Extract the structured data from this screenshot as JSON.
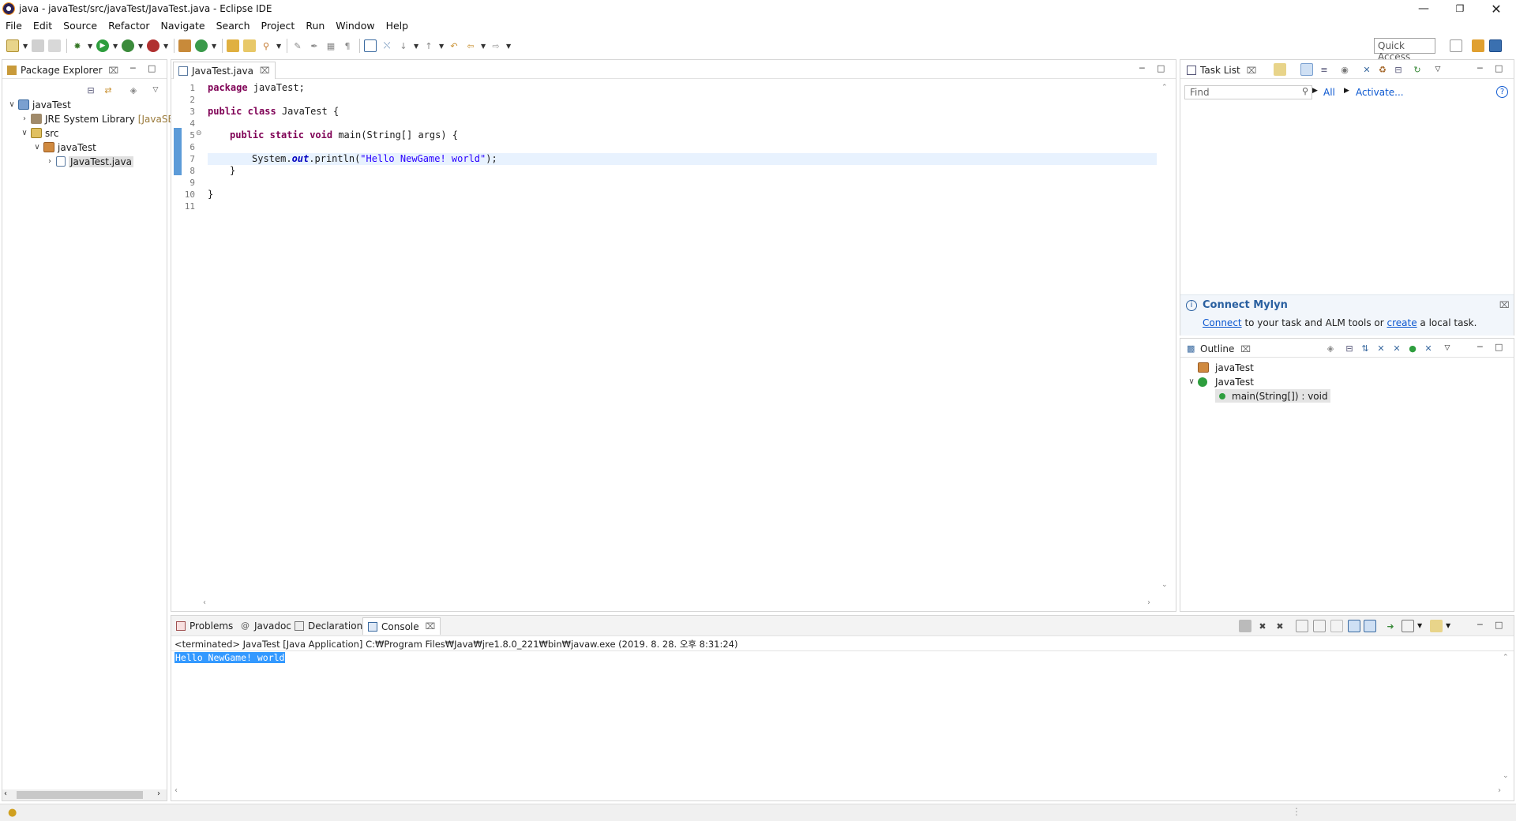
{
  "window": {
    "title": "java - javaTest/src/javaTest/JavaTest.java - Eclipse IDE"
  },
  "menu": [
    "File",
    "Edit",
    "Source",
    "Refactor",
    "Navigate",
    "Search",
    "Project",
    "Run",
    "Window",
    "Help"
  ],
  "toolbar": {
    "quick_access": "Quick Access"
  },
  "package_explorer": {
    "tab_label": "Package Explorer",
    "tree": {
      "project": "javaTest",
      "jre": "JRE System Library",
      "jre_suffix": "[JavaSE-",
      "src": "src",
      "package": "javaTest",
      "file": "JavaTest.java"
    }
  },
  "editor": {
    "tab_label": "JavaTest.java",
    "line_numbers": [
      "1",
      "2",
      "3",
      "4",
      "5",
      "6",
      "7",
      "8",
      "9",
      "10",
      "11"
    ],
    "code": {
      "l1_kw": "package",
      "l1_rest": " javaTest;",
      "l3_kw1": "public",
      "l3_kw2": "class",
      "l3_rest": " JavaTest {",
      "l5_kw1": "public",
      "l5_kw2": "static",
      "l5_kw3": "void",
      "l5_rest": " main(String[] args) {",
      "l7_a": "System.",
      "l7_field": "out",
      "l7_b": ".println(",
      "l7_str": "\"Hello NewGame! world\"",
      "l7_c": ");",
      "l8": "}",
      "l10": "}"
    }
  },
  "task_list": {
    "tab_label": "Task List",
    "find_placeholder": "Find",
    "all_label": "All",
    "activate_label": "Activate..."
  },
  "mylyn": {
    "title": "Connect Mylyn",
    "connect_link": "Connect",
    "middle_text": " to your task and ALM tools or ",
    "create_link": "create",
    "end_text": " a local task."
  },
  "outline": {
    "tab_label": "Outline",
    "package": "javaTest",
    "class": "JavaTest",
    "method": "main(String[]) : void"
  },
  "bottom_tabs": {
    "problems": "Problems",
    "javadoc": "Javadoc",
    "declaration": "Declaration",
    "console": "Console"
  },
  "console": {
    "header": "<terminated> JavaTest [Java Application] C:₩Program Files₩Java₩jre1.8.0_221₩bin₩javaw.exe (2019. 8. 28. 오후 8:31:24)",
    "output": "Hello NewGame! world"
  },
  "colors": {
    "keyword": "#7f0055",
    "string": "#2a00ff",
    "field": "#0000c0",
    "selection": "#3399ff",
    "current_line": "#e8f2fe"
  }
}
